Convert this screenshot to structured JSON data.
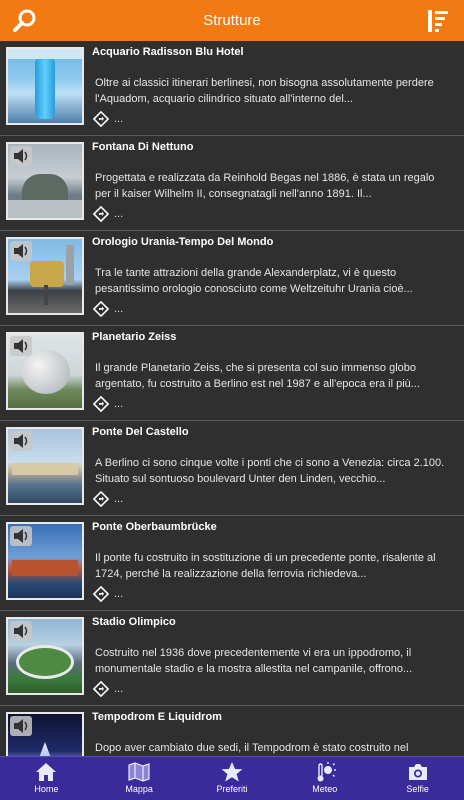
{
  "header": {
    "title": "Strutture",
    "search_icon": "search-icon",
    "sort_icon": "sort-list-icon",
    "color": "#f27a12"
  },
  "items": [
    {
      "name": "Acquario Radisson Blu Hotel",
      "description": "Oltre ai classici itinerari berlinesi, non bisogna assolutamente perdere l'Aquadom, acquario cilindrico situato all'interno del...",
      "more": "...",
      "audio": false
    },
    {
      "name": "Fontana Di Nettuno",
      "description": "Progettata e realizzata da Reinhold Begas nel 1886, è stata un regalo per il kaiser Wilhelm II, consegnatagli nell'anno 1891. Il...",
      "more": "...",
      "audio": true
    },
    {
      "name": "Orologio Urania-Tempo Del Mondo",
      "description": "Tra le tante attrazioni della grande Alexanderplatz, vi è questo pesantissimo orologio conosciuto come Weltzeituhr Urania cioè...",
      "more": "...",
      "audio": true
    },
    {
      "name": "Planetario Zeiss",
      "description": "Il grande Planetario Zeiss, che si presenta col suo immenso globo argentato, fu costruito a Berlino est nel 1987 e all'epoca era il più...",
      "more": "...",
      "audio": true
    },
    {
      "name": "Ponte Del Castello",
      "description": "A Berlino ci sono cinque volte i ponti che ci sono a Venezia: circa 2.100. Situato sul sontuoso boulevard Unter den Linden, vecchio...",
      "more": "...",
      "audio": true
    },
    {
      "name": "Ponte Oberbaumbrücke",
      "description": "Il ponte fu costruito in sostituzione di un precedente ponte, risalente al 1724, perché la realizzazione della ferrovia richiedeva...",
      "more": "...",
      "audio": true
    },
    {
      "name": "Stadio Olimpico",
      "description": "Costruito nel 1936 dove precedentemente vi era un ippodromo, il monumentale stadio e la mostra allestita nel campanile, offrono...",
      "more": "...",
      "audio": true
    },
    {
      "name": "Tempodrom E Liquidrom",
      "description": "Dopo aver cambiato due sedi, il Tempodrom è stato costruito nel",
      "more": "",
      "audio": true
    }
  ],
  "bottom_nav": [
    {
      "label": "Home",
      "icon": "home-icon"
    },
    {
      "label": "Mappa",
      "icon": "map-icon"
    },
    {
      "label": "Preferiti",
      "icon": "star-icon"
    },
    {
      "label": "Meteo",
      "icon": "weather-icon"
    },
    {
      "label": "Selfie",
      "icon": "camera-icon"
    }
  ],
  "colors": {
    "accent": "#f27a12",
    "list_bg": "#2f2f2f",
    "nav_bg": "#3b2a9a"
  }
}
